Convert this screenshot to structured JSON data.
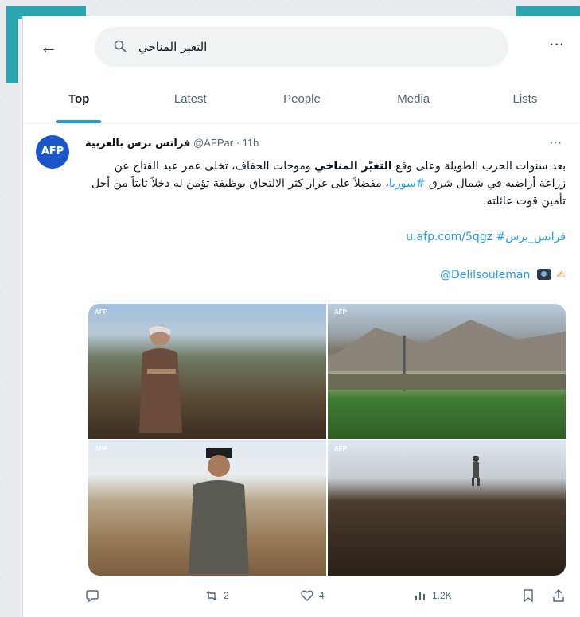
{
  "search": {
    "query": "التغير المناخي"
  },
  "tabs": [
    {
      "label": "Top",
      "active": true
    },
    {
      "label": "Latest"
    },
    {
      "label": "People"
    },
    {
      "label": "Media"
    },
    {
      "label": "Lists"
    }
  ],
  "tweet": {
    "avatar_text": "AFP",
    "author": "فرانس برس بالعربية",
    "handle_time": "@AFPar · 11h",
    "more": "···",
    "body_pre": "بعد سنوات الحرب الطويلة وعلى وقع ",
    "body_kw": "التغيّر المناخي",
    "body_mid": " وموجات الجفاف، تخلى عمر عبد الفتاح عن زراعة أراضيه في شمال شرق ",
    "body_tag": "#سوريا",
    "body_post": "، مفضلاً على غرار كثر الالتحاق بوظيفة تؤمن له دخلاً ثابتاً من أجل تأمين قوت عائلته.",
    "link_line": "u.afp.com/5qgz #فرانس_برس",
    "mention": "@Delilsouleman",
    "photo_watermark": "AFP",
    "stats": {
      "retweets": "2",
      "likes": "4",
      "views": "1.2K"
    }
  },
  "colors": {
    "accent": "#1d9bf0",
    "brand_teal": "#2aa6b0",
    "avatar_bg": "#1a56c9"
  }
}
